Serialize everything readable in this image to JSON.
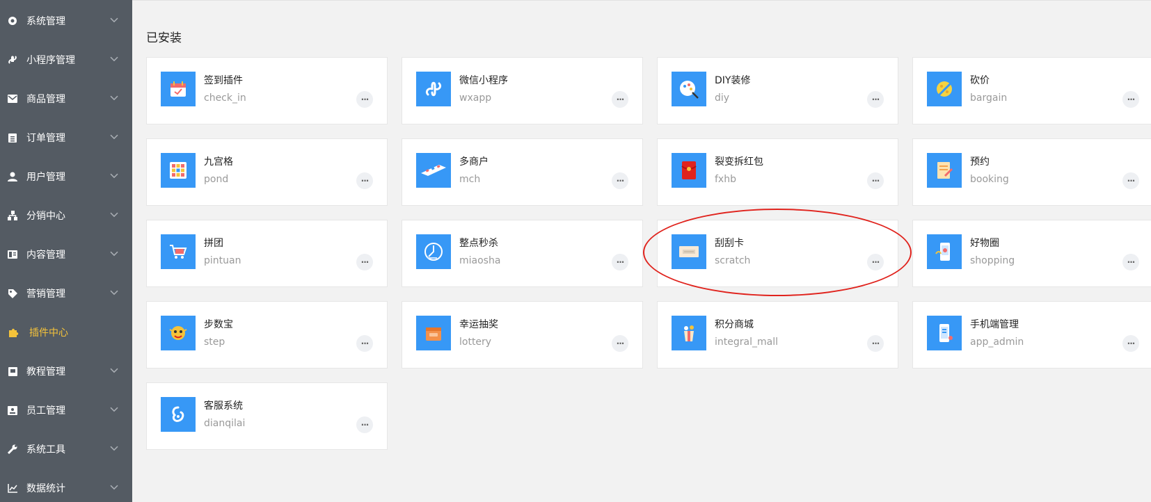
{
  "sidebar": {
    "items": [
      {
        "label": "系统管理",
        "icon": "gear-icon",
        "active": false
      },
      {
        "label": "小程序管理",
        "icon": "link-icon",
        "active": false
      },
      {
        "label": "商品管理",
        "icon": "envelope-icon",
        "active": false
      },
      {
        "label": "订单管理",
        "icon": "clipboard-icon",
        "active": false
      },
      {
        "label": "用户管理",
        "icon": "user-icon",
        "active": false
      },
      {
        "label": "分销中心",
        "icon": "sitemap-icon",
        "active": false
      },
      {
        "label": "内容管理",
        "icon": "content-icon",
        "active": false
      },
      {
        "label": "营销管理",
        "icon": "tag-icon",
        "active": false
      },
      {
        "label": "插件中心",
        "icon": "puzzle-icon",
        "active": true
      },
      {
        "label": "教程管理",
        "icon": "book-icon",
        "active": false
      },
      {
        "label": "员工管理",
        "icon": "badge-icon",
        "active": false
      },
      {
        "label": "系统工具",
        "icon": "wrench-icon",
        "active": false
      },
      {
        "label": "数据统计",
        "icon": "chart-line-icon",
        "active": false
      }
    ]
  },
  "main": {
    "section_title": "已安装",
    "more_label": "···",
    "plugins": [
      {
        "name": "签到插件",
        "code": "check_in",
        "icon": "calendar-check-icon"
      },
      {
        "name": "微信小程序",
        "code": "wxapp",
        "icon": "mini-program-icon"
      },
      {
        "name": "DIY装修",
        "code": "diy",
        "icon": "diy-brush-icon"
      },
      {
        "name": "砍价",
        "code": "bargain",
        "icon": "bargain-icon"
      },
      {
        "name": "九宫格",
        "code": "pond",
        "icon": "grid-icon"
      },
      {
        "name": "多商户",
        "code": "mch",
        "icon": "multi-store-icon"
      },
      {
        "name": "裂变拆红包",
        "code": "fxhb",
        "icon": "red-envelope-icon"
      },
      {
        "name": "预约",
        "code": "booking",
        "icon": "booking-icon"
      },
      {
        "name": "拼团",
        "code": "pintuan",
        "icon": "cart-icon"
      },
      {
        "name": "整点秒杀",
        "code": "miaosha",
        "icon": "clock-icon"
      },
      {
        "name": "刮刮卡",
        "code": "scratch",
        "icon": "scratch-card-icon"
      },
      {
        "name": "好物圈",
        "code": "shopping",
        "icon": "shopping-phone-icon"
      },
      {
        "name": "步数宝",
        "code": "step",
        "icon": "step-mascot-icon"
      },
      {
        "name": "幸运抽奖",
        "code": "lottery",
        "icon": "lottery-box-icon"
      },
      {
        "name": "积分商城",
        "code": "integral_mall",
        "icon": "gift-icon"
      },
      {
        "name": "手机端管理",
        "code": "app_admin",
        "icon": "mobile-admin-icon"
      },
      {
        "name": "客服系统",
        "code": "dianqilai",
        "icon": "customer-service-icon"
      }
    ]
  },
  "colors": {
    "sidebar_bg": "#545b63",
    "active_text": "#f5c33a",
    "icon_bg": "#3798f6",
    "highlight": "#e0231d"
  }
}
